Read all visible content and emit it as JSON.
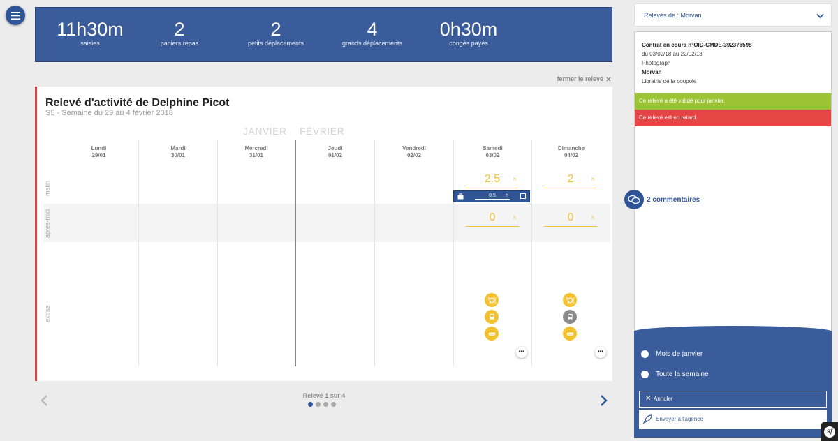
{
  "stats": [
    {
      "value": "11h30m",
      "label": "saisies"
    },
    {
      "value": "2",
      "label": "paniers repas"
    },
    {
      "value": "2",
      "label": "petits déplacements"
    },
    {
      "value": "4",
      "label": "grands déplacements"
    },
    {
      "value": "0h30m",
      "label": "congés payés"
    }
  ],
  "close_label": "fermer le relevé",
  "card": {
    "title": "Relevé d'activité de Delphine Picot",
    "subtitle": "S5 - Semaine du 29 au 4 février 2018",
    "month_left": "JANVIER",
    "month_right": "FÉVRIER"
  },
  "rows": {
    "matin": "matin",
    "apres_midi": "après-midi",
    "extras": "extras"
  },
  "days": [
    {
      "name": "Lundi",
      "date": "29/01"
    },
    {
      "name": "Mardi",
      "date": "30/01"
    },
    {
      "name": "Mercredi",
      "date": "31/01"
    },
    {
      "name": "Jeudi",
      "date": "01/02"
    },
    {
      "name": "Vendredi",
      "date": "02/02"
    },
    {
      "name": "Samedi",
      "date": "03/02"
    },
    {
      "name": "Dimanche",
      "date": "04/02"
    }
  ],
  "entries": {
    "samedi_matin": "2.5",
    "dimanche_matin": "2",
    "samedi_apres_midi": "0",
    "dimanche_apres_midi": "0",
    "unit": "h",
    "popover_value": "0.5",
    "popover_unit": "h",
    "more": "•••"
  },
  "extras_icons": {
    "samedi": [
      "meal-icon",
      "train-icon",
      "car-icon"
    ],
    "dimanche": [
      "meal-icon",
      "train-icon",
      "car-icon"
    ]
  },
  "pager": {
    "label": "Relevé 1 sur 4",
    "current": 1,
    "total": 4
  },
  "right_panel": {
    "select_label": "Relevés de : Morvan",
    "contract": "Contrat en cours n°OID-CMDE-392376598",
    "period": "du 03/02/18 au 22/02/18",
    "job": "Photograph",
    "client": "Morvan",
    "location": "Librairie de la coupole",
    "alert_ok": "Ce relevé a été validé pour janvier.",
    "alert_late": "Ce relevé est en retard.",
    "comments": "2 commentaires",
    "option_month": "Mois de janvier",
    "option_week": "Toute la semaine",
    "cancel_label": "Annuler",
    "send_label": "Envoyer à l'agence"
  },
  "colors": {
    "primary": "#3a5c9a",
    "accent": "#f2c230",
    "ok": "#9cc334",
    "late": "#e64545",
    "border_red": "#e53b42"
  }
}
